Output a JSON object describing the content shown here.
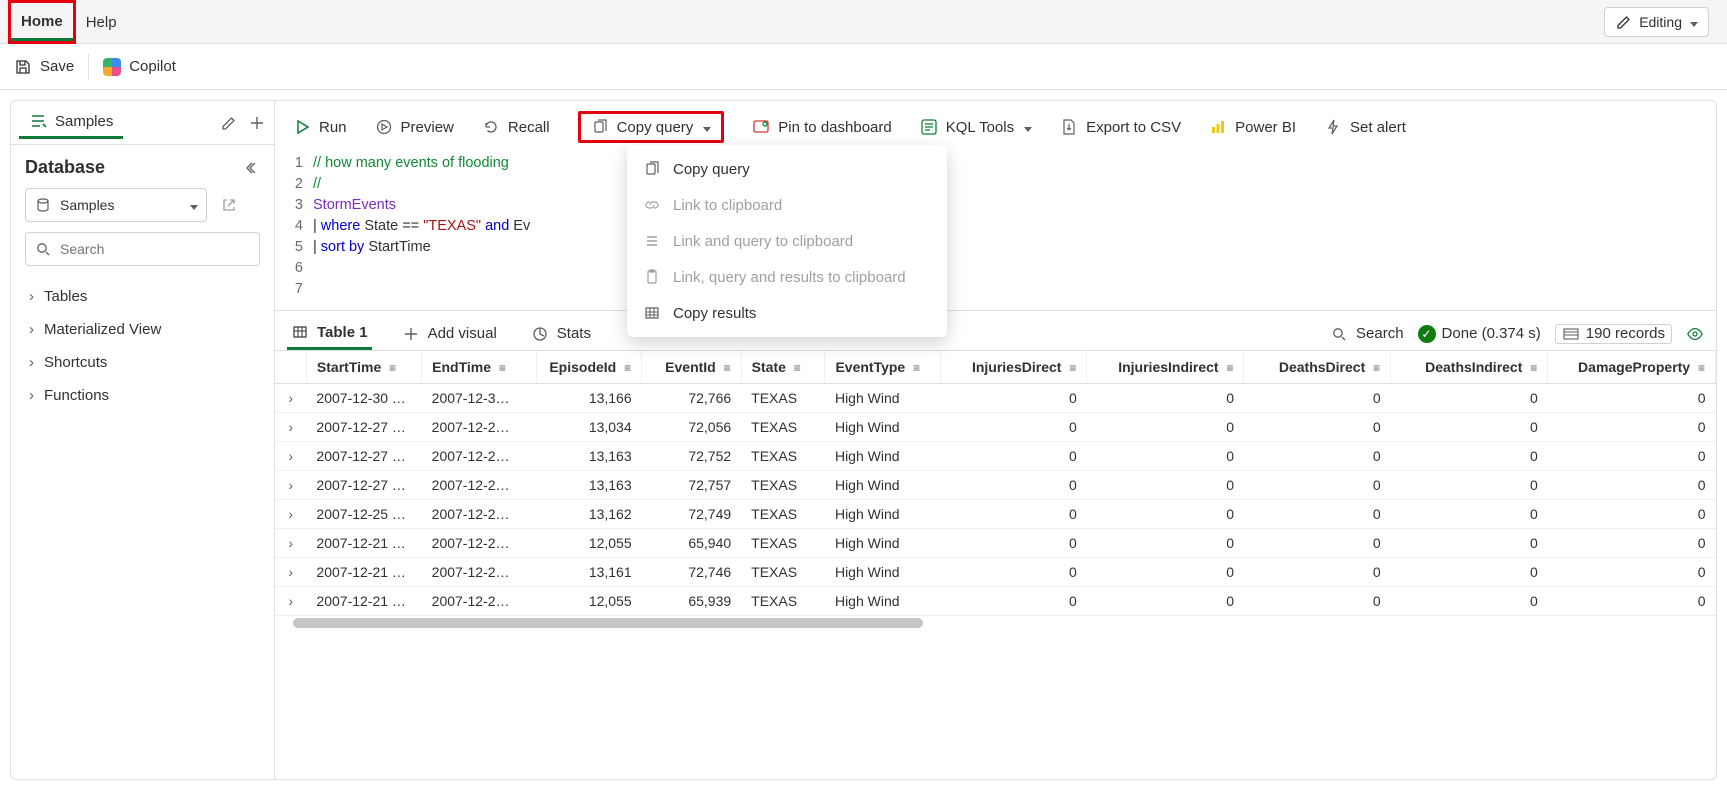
{
  "nav": {
    "home": "Home",
    "help": "Help",
    "editing": "Editing"
  },
  "toolbar2": {
    "save": "Save",
    "copilot": "Copilot"
  },
  "sidebar": {
    "tab_label": "Samples",
    "heading": "Database",
    "db_select": "Samples",
    "search_placeholder": "Search",
    "tree": [
      "Tables",
      "Materialized View",
      "Shortcuts",
      "Functions"
    ]
  },
  "query_toolbar": {
    "run": "Run",
    "preview": "Preview",
    "recall": "Recall",
    "copy_query": "Copy query",
    "pin": "Pin to dashboard",
    "kql_tools": "KQL Tools",
    "export_csv": "Export to CSV",
    "power_bi": "Power BI",
    "set_alert": "Set alert"
  },
  "copy_menu": {
    "copy_query": "Copy query",
    "link_clip": "Link to clipboard",
    "link_query_clip": "Link and query to clipboard",
    "link_query_results": "Link, query and results to clipboard",
    "copy_results": "Copy results"
  },
  "editor": {
    "lines": [
      "// how many events of flooding ",
      "//",
      "StormEvents",
      "| where State == \"TEXAS\" and Ev",
      "| sort by StartTime",
      "",
      ""
    ]
  },
  "results_bar": {
    "table1": "Table 1",
    "add_visual": "Add visual",
    "stats": "Stats",
    "search": "Search",
    "done": "Done (0.374 s)",
    "records": "190 records"
  },
  "grid": {
    "cols": [
      "StartTime",
      "EndTime",
      "EpisodeId",
      "EventId",
      "State",
      "EventType",
      "InjuriesDirect",
      "InjuriesIndirect",
      "DeathsDirect",
      "DeathsIndirect",
      "DamageProperty"
    ],
    "rows": [
      [
        "2007-12-30 …",
        "2007-12-3…",
        "13,166",
        "72,766",
        "TEXAS",
        "High Wind",
        "0",
        "0",
        "0",
        "0",
        "0"
      ],
      [
        "2007-12-27 …",
        "2007-12-2…",
        "13,034",
        "72,056",
        "TEXAS",
        "High Wind",
        "0",
        "0",
        "0",
        "0",
        "0"
      ],
      [
        "2007-12-27 …",
        "2007-12-2…",
        "13,163",
        "72,752",
        "TEXAS",
        "High Wind",
        "0",
        "0",
        "0",
        "0",
        "0"
      ],
      [
        "2007-12-27 …",
        "2007-12-2…",
        "13,163",
        "72,757",
        "TEXAS",
        "High Wind",
        "0",
        "0",
        "0",
        "0",
        "0"
      ],
      [
        "2007-12-25 …",
        "2007-12-2…",
        "13,162",
        "72,749",
        "TEXAS",
        "High Wind",
        "0",
        "0",
        "0",
        "0",
        "0"
      ],
      [
        "2007-12-21 …",
        "2007-12-2…",
        "12,055",
        "65,940",
        "TEXAS",
        "High Wind",
        "0",
        "0",
        "0",
        "0",
        "0"
      ],
      [
        "2007-12-21 …",
        "2007-12-2…",
        "13,161",
        "72,746",
        "TEXAS",
        "High Wind",
        "0",
        "0",
        "0",
        "0",
        "0"
      ],
      [
        "2007-12-21 …",
        "2007-12-2…",
        "12,055",
        "65,939",
        "TEXAS",
        "High Wind",
        "0",
        "0",
        "0",
        "0",
        "0"
      ]
    ]
  }
}
